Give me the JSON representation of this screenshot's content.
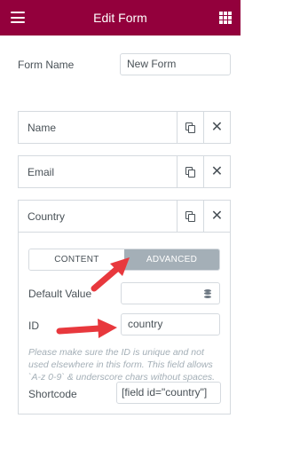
{
  "header": {
    "title": "Edit Form",
    "menu_icon": "hamburger-icon",
    "apps_icon": "grid-icon",
    "background": "#93003c"
  },
  "form_name": {
    "label": "Form Name",
    "value": "New Form"
  },
  "fields": [
    {
      "title": "Name"
    },
    {
      "title": "Email"
    },
    {
      "title": "Country"
    }
  ],
  "country_editor": {
    "tabs": [
      "CONTENT",
      "ADVANCED"
    ],
    "active_tab": "ADVANCED",
    "default_value": {
      "label": "Default Value",
      "value": ""
    },
    "id": {
      "label": "ID",
      "value": "country"
    },
    "help_text": "Please make sure the ID is unique and not used elsewhere in this form. This field allows `A-z 0-9` & underscore chars without spaces.",
    "shortcode": {
      "label": "Shortcode",
      "value": "[field id=\"country\"]"
    }
  },
  "annotation_color": "#e8383d"
}
